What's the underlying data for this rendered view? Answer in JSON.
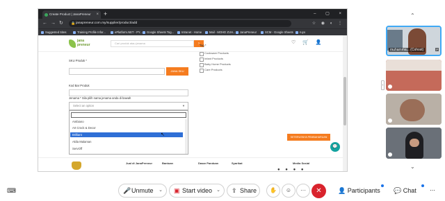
{
  "browser": {
    "tab_title": "Create Product | JanaPreneur",
    "tab_close": "×",
    "new_tab": "+",
    "window_controls": "– ▢ ×",
    "url": "janapreneur.com.my/supplier/product/add",
    "bookmarks": [
      "Suggested Sites",
      "Training Profile Infor...",
      "ePlatform.NET - PY...",
      "Google Sheets Tog...",
      "Intranet - Home",
      "Mail - MOHD ZUH...",
      "JanaPreneur",
      "SCM - Google Sheets",
      "ruyo"
    ]
  },
  "site": {
    "logo_text": "jana\npreneur",
    "search_placeholder": "Cari produk atau jenama",
    "search_go": "›",
    "header_icons": "♡ 🛒 👤",
    "sku_label": "SKU Produk *",
    "tag_label": "Tag *",
    "jana_button": "JANA SKU",
    "barcode_label": "Kod Bar Produk",
    "brand_label": "Jenama * Sila pilih nama jenama anda di bawah",
    "select_placeholder": "Select an option",
    "select_caret": "▼",
    "options": [
      "Ambiano",
      "Art Crock & Decor",
      "Brilliant",
      "Akila Malaman",
      "ServOff"
    ],
    "selected_option": "Brilliant",
    "tags": [
      "Cookware Products",
      "Infant Products",
      "Baby Home Products",
      "Care Products"
    ],
    "save_button": "SETERUSNYA PEMBAHARUAN",
    "footer": [
      "Jual di JanaPreneur",
      "Bantuan",
      "Dasar Panduan",
      "Syarikat",
      "Media Sosial"
    ],
    "social_icons": "● ● ● ●",
    "chat_icon": "💬"
  },
  "participants": {
    "first_name": "muhamma... (Cohost)",
    "first_badge": "P"
  },
  "toolbar": {
    "unmute": "Unmute",
    "start_video": "Start video",
    "share": "Share",
    "participants": "Participants",
    "chat": "Chat",
    "more": "···",
    "hand": "✋",
    "react": "☺",
    "leave": "✕",
    "chevron": "⌄"
  }
}
